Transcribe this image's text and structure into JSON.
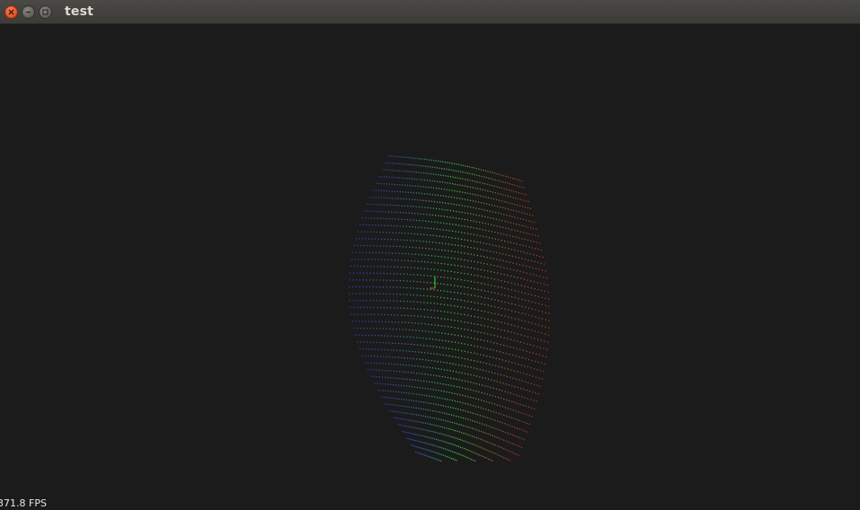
{
  "window": {
    "title": "test",
    "close_icon": "close-icon",
    "minimize_icon": "minimize-icon",
    "maximize_icon": "maximize-icon"
  },
  "viewport": {
    "background_color": "#1b1b1b",
    "fps_text": "371.8 FPS",
    "point_colors": [
      "#3b4bff",
      "#36e03a",
      "#ff3b2a"
    ]
  }
}
